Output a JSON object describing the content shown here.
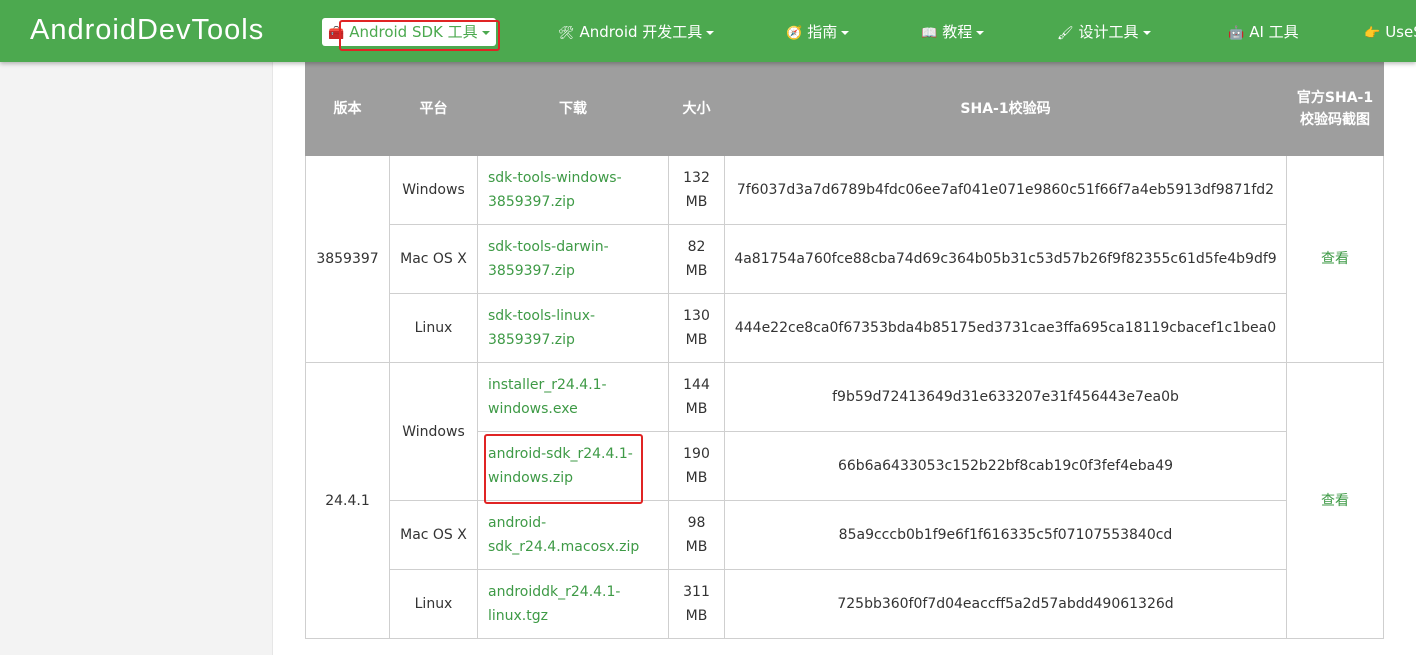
{
  "nav": {
    "logo": "AndroidDevTools",
    "items": [
      {
        "icon": "🧰",
        "label": "Android SDK 工具",
        "active": true
      },
      {
        "icon": "🛠",
        "label": "Android 开发工具"
      },
      {
        "icon": "🧭",
        "label": "指南"
      },
      {
        "icon": "📖",
        "label": "教程"
      },
      {
        "icon": "🖌",
        "label": "设计工具"
      },
      {
        "icon": "🤖",
        "label": "AI 工具"
      },
      {
        "icon": "👉",
        "label": "UseS"
      }
    ]
  },
  "table": {
    "headers": [
      "版本",
      "平台",
      "下载",
      "大小",
      "SHA-1校验码",
      "官方SHA-1校验码截图"
    ],
    "groups": [
      {
        "version": "3859397",
        "view_label": "查看",
        "rows": [
          {
            "platform": "Windows",
            "file": "sdk-tools-windows-3859397.zip",
            "size": "132 MB",
            "sha1": "7f6037d3a7d6789b4fdc06ee7af041e071e9860c51f66f7a4eb5913df9871fd2"
          },
          {
            "platform": "Mac OS X",
            "file": "sdk-tools-darwin-3859397.zip",
            "size": "82 MB",
            "sha1": "4a81754a760fce88cba74d69c364b05b31c53d57b26f9f82355c61d5fe4b9df9"
          },
          {
            "platform": "Linux",
            "file": "sdk-tools-linux-3859397.zip",
            "size": "130 MB",
            "sha1": "444e22ce8ca0f67353bda4b85175ed3731cae3ffa695ca18119cbacef1c1bea0"
          }
        ]
      },
      {
        "version": "24.4.1",
        "view_label": "查看",
        "rows": [
          {
            "platform": "Windows",
            "file": "installer_r24.4.1-windows.exe",
            "size": "144 MB",
            "sha1": "f9b59d72413649d31e633207e31f456443e7ea0b"
          },
          {
            "platform": "",
            "file": "android-sdk_r24.4.1-windows.zip",
            "size": "190 MB",
            "sha1": "66b6a6433053c152b22bf8cab19c0f3fef4eba49"
          },
          {
            "platform": "Mac OS X",
            "file": "android-sdk_r24.4.macosx.zip",
            "size": "98 MB",
            "sha1": "85a9cccb0b1f9e6f1f616335c5f07107553840cd"
          },
          {
            "platform": "Linux",
            "file": "androiddk_r24.4.1-linux.tgz",
            "size": "311 MB",
            "sha1": "725bb360f0f7d04eaccff5a2d57abdd49061326d"
          }
        ]
      }
    ]
  },
  "colors": {
    "nav_bg": "#4ca94f",
    "link": "#3e9a46",
    "header_bg": "#9e9e9e",
    "highlight": "#e02424"
  }
}
